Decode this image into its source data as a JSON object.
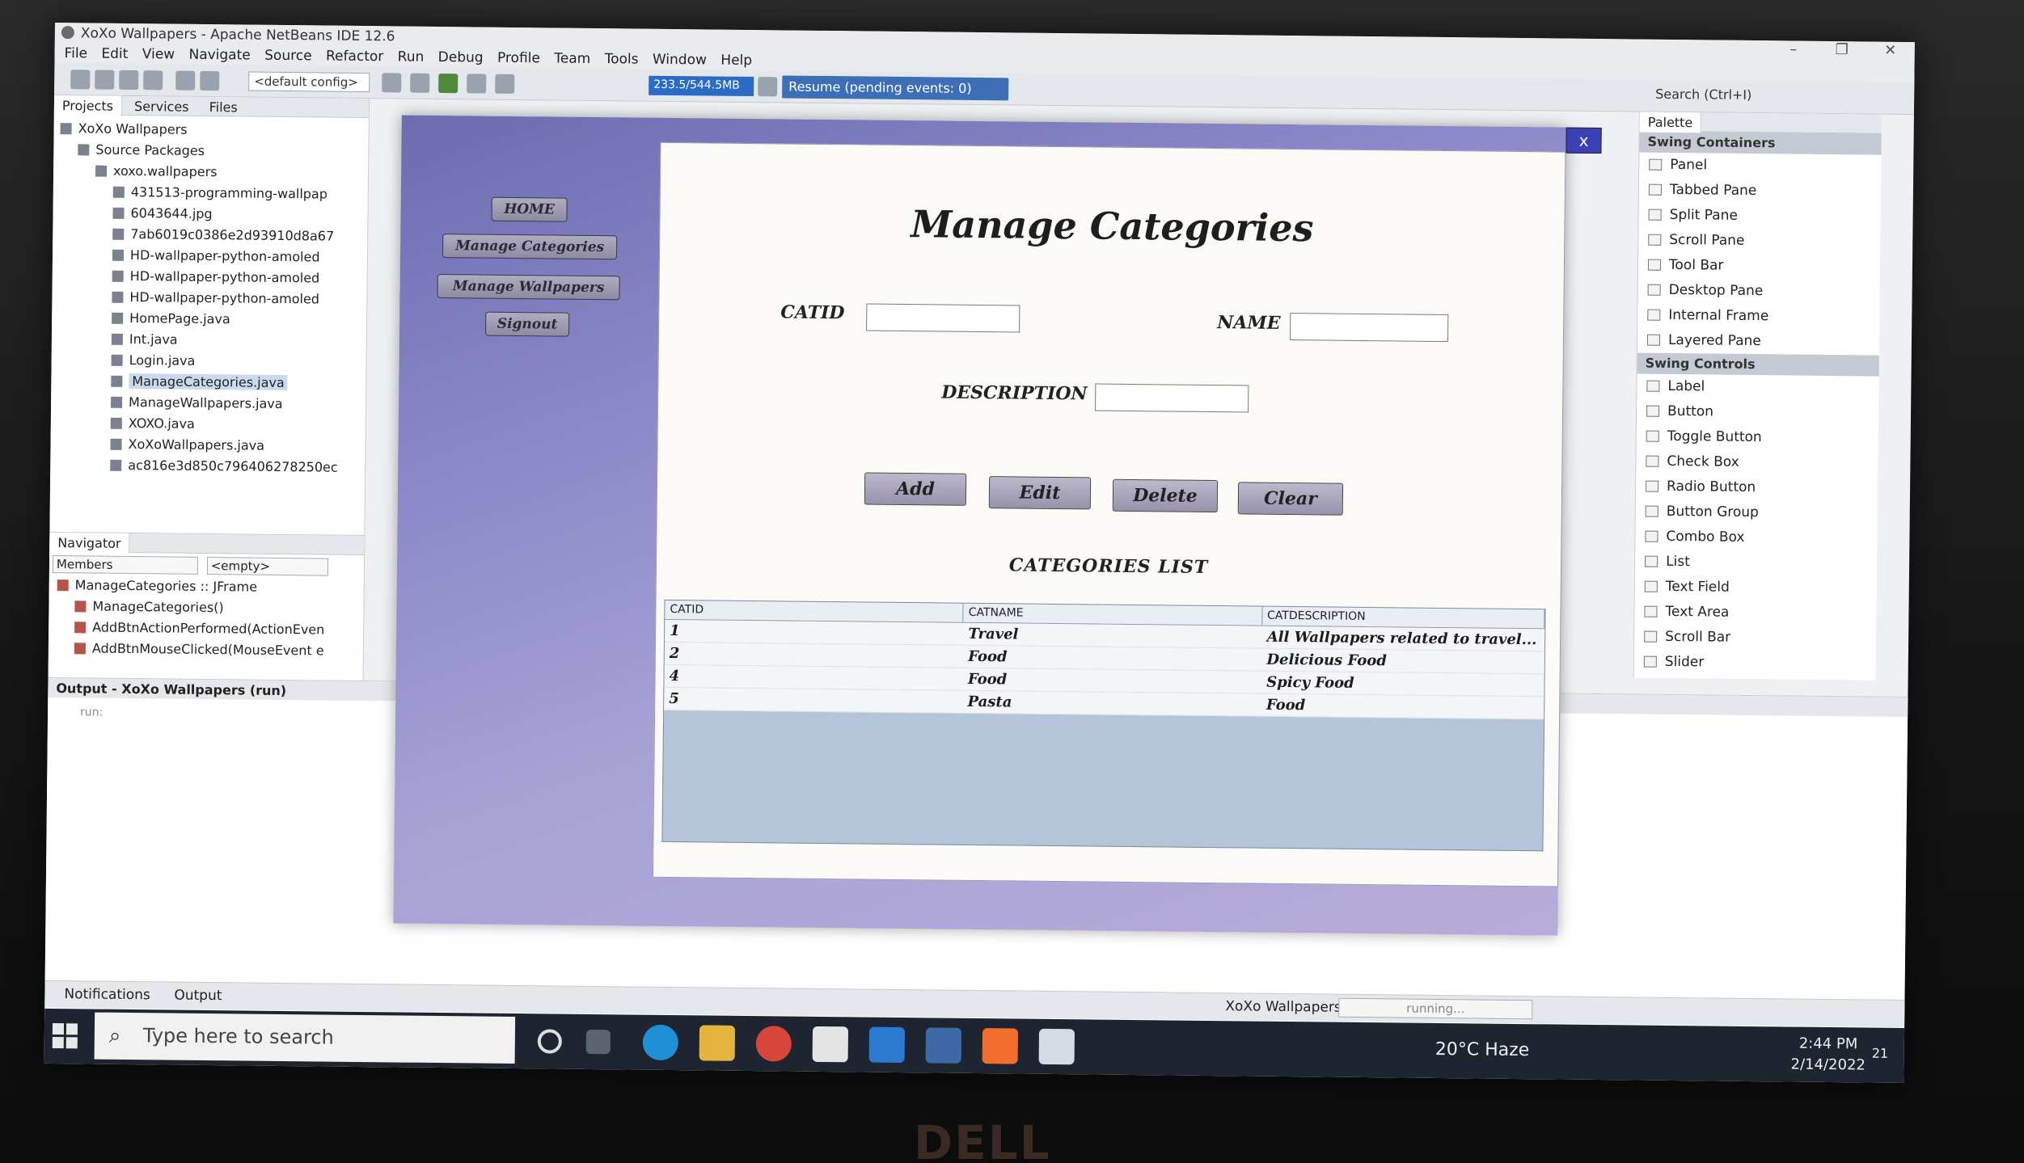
{
  "ide": {
    "title": "XoXo Wallpapers - Apache NetBeans IDE 12.6",
    "menu": [
      "File",
      "Edit",
      "View",
      "Navigate",
      "Source",
      "Refactor",
      "Run",
      "Debug",
      "Profile",
      "Team",
      "Tools",
      "Window",
      "Help"
    ],
    "config": "<default config>",
    "memory": "233.5/544.5MB",
    "resume": "Resume (pending events: 0)",
    "search": "Search (Ctrl+I)"
  },
  "projects": {
    "tabs": [
      "Projects",
      "Services",
      "Files"
    ],
    "items": [
      {
        "label": "XoXo Wallpapers",
        "indent": 0
      },
      {
        "label": "Source Packages",
        "indent": 1
      },
      {
        "label": "xoxo.wallpapers",
        "indent": 2
      },
      {
        "label": "431513-programming-wallpap",
        "indent": 3
      },
      {
        "label": "6043644.jpg",
        "indent": 3
      },
      {
        "label": "7ab6019c0386e2d93910d8a67",
        "indent": 3
      },
      {
        "label": "HD-wallpaper-python-amoled",
        "indent": 3
      },
      {
        "label": "HD-wallpaper-python-amoled",
        "indent": 3
      },
      {
        "label": "HD-wallpaper-python-amoled",
        "indent": 3
      },
      {
        "label": "HomePage.java",
        "indent": 3
      },
      {
        "label": "Int.java",
        "indent": 3
      },
      {
        "label": "Login.java",
        "indent": 3
      },
      {
        "label": "ManageCategories.java",
        "indent": 3,
        "selected": true
      },
      {
        "label": "ManageWallpapers.java",
        "indent": 3
      },
      {
        "label": "XOXO.java",
        "indent": 3
      },
      {
        "label": "XoXoWallpapers.java",
        "indent": 3
      },
      {
        "label": "ac816e3d850c796406278250ec",
        "indent": 3
      }
    ]
  },
  "navigator": {
    "title": "Navigator",
    "filter": "Members",
    "filter2": "<empty>",
    "items": [
      {
        "label": "ManageCategories :: JFrame",
        "indent": 0
      },
      {
        "label": "ManageCategories()",
        "indent": 1
      },
      {
        "label": "AddBtnActionPerformed(ActionEven",
        "indent": 1
      },
      {
        "label": "AddBtnMouseClicked(MouseEvent e",
        "indent": 1
      }
    ]
  },
  "output": {
    "title": "Output - XoXo Wallpapers (run)",
    "text": "run:"
  },
  "status": {
    "notifications": "Notifications",
    "output": "Output",
    "process": "XoXo Wallpapers (run)",
    "progress": "running..."
  },
  "palette": {
    "title": "Palette",
    "groups": [
      {
        "name": "Swing Containers",
        "items": [
          "Panel",
          "Tabbed Pane",
          "Split Pane",
          "Scroll Pane",
          "Tool Bar",
          "Desktop Pane",
          "Internal Frame",
          "Layered Pane"
        ]
      },
      {
        "name": "Swing Controls",
        "items": [
          "Label",
          "Button",
          "Toggle Button",
          "Check Box",
          "Radio Button",
          "Button Group",
          "Combo Box",
          "List",
          "Text Field",
          "Text Area",
          "Scroll Bar",
          "Slider"
        ]
      }
    ]
  },
  "app": {
    "close": "x",
    "nav": [
      "HOME",
      "Manage Categories",
      "Manage Wallpapers",
      "Signout"
    ],
    "title": "Manage Categories",
    "labels": {
      "catid": "CATID",
      "name": "NAME",
      "description": "DESCRIPTION"
    },
    "values": {
      "catid": "",
      "name": "",
      "description": ""
    },
    "buttons": [
      "Add",
      "Edit",
      "Delete",
      "Clear"
    ],
    "list_title": "CATEGORIES LIST",
    "table": {
      "headers": [
        "CATID",
        "CATNAME",
        "CATDESCRIPTION"
      ],
      "rows": [
        [
          "1",
          "Travel",
          "All Wallpapers related to travel..."
        ],
        [
          "2",
          "Food",
          "Delicious Food"
        ],
        [
          "4",
          "Food",
          "Spicy Food"
        ],
        [
          "5",
          "Pasta",
          "Food"
        ]
      ]
    }
  },
  "taskbar": {
    "search": "Type here to search",
    "weather": "20°C  Haze",
    "time": "2:44 PM",
    "date": "2/14/2022",
    "notif_count": "21"
  },
  "brand": "DELL"
}
